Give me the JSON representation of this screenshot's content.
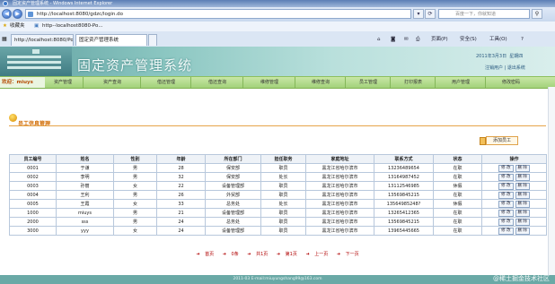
{
  "browser": {
    "title": "固定资产管理系统 - Windows Internet Explorer",
    "url": "http://localhost:8080/gdzc/login.do",
    "search_placeholder": "百度一下，你就知道",
    "favorites_label": "收藏夹",
    "favorite_link": "http--localhost8080-Po...",
    "tabs": [
      "http://localhost:8080/Po...",
      "固定资产管理系统"
    ],
    "commands": [
      "页面(P)",
      "安全(S)",
      "工具(O)",
      "?"
    ]
  },
  "header": {
    "system_name": "固定资产管理系统",
    "date": "2011年3月3日",
    "weekday": "星期四",
    "user_links": [
      "注销用户",
      "退出系统"
    ]
  },
  "menu": {
    "welcome": "欢迎：miuys",
    "items": [
      "资产管理",
      "资产查询",
      "借还管理",
      "借还查询",
      "维修管理",
      "维修查询",
      "员工管理",
      "打印报表",
      "用户管理",
      "修改密码"
    ]
  },
  "section": {
    "title": "员工信息管理",
    "add_button": "添加员工"
  },
  "table": {
    "columns": [
      "员工编号",
      "姓名",
      "性别",
      "年龄",
      "所在部门",
      "担任职务",
      "家庭地址",
      "联系方式",
      "状态",
      "操作"
    ],
    "rows": [
      [
        "0001",
        "于谦",
        "男",
        "28",
        "保安部",
        "职员",
        "黑龙江省哈尔滨市",
        "13236489654",
        "在职"
      ],
      [
        "0002",
        "李明",
        "男",
        "32",
        "保安部",
        "处长",
        "黑龙江省哈尔滨市",
        "13164987452",
        "在职"
      ],
      [
        "0003",
        "孙丽",
        "女",
        "22",
        "设备管理部",
        "职员",
        "黑龙江省哈尔滨市",
        "13112546985",
        "休假"
      ],
      [
        "0004",
        "王利",
        "男",
        "26",
        "外贸部",
        "职员",
        "黑龙江省哈尔滨市",
        "13569845215",
        "在职"
      ],
      [
        "0005",
        "王霞",
        "女",
        "33",
        "总务处",
        "处长",
        "黑龙江省哈尔滨市",
        "13564985248?",
        "休假"
      ],
      [
        "1000",
        "miuys",
        "男",
        "21",
        "设备管理部",
        "职员",
        "黑龙江省哈尔滨市",
        "13265412365",
        "在职"
      ],
      [
        "2000",
        "sss",
        "男",
        "24",
        "总务处",
        "职员",
        "黑龙江省哈尔滨市",
        "13569845215",
        "在职"
      ],
      [
        "3000",
        "yyy",
        "女",
        "24",
        "设备管理部",
        "职员",
        "黑龙江省哈尔滨市",
        "13965445665",
        "在职"
      ]
    ],
    "edit_label": "修 改",
    "delete_label": "删 除"
  },
  "pager": [
    "首页",
    "0条",
    "共1页",
    "第1页",
    "上一页",
    "下一页"
  ],
  "footer": "2011-03 E-mail:miuyungshang99@163.com",
  "watermark": "@稀土掘金技术社区"
}
